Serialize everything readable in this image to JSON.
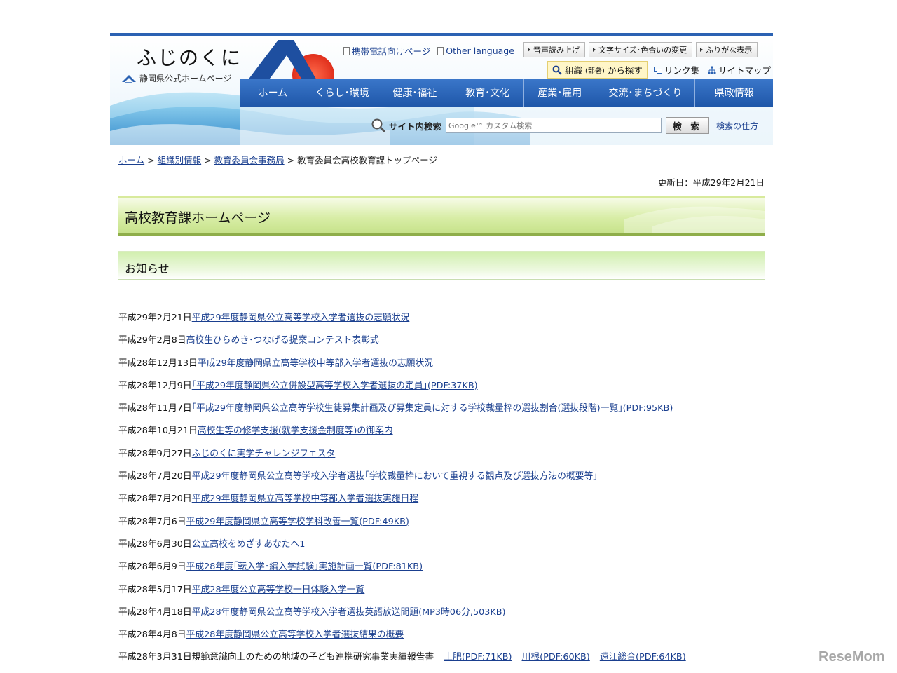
{
  "header": {
    "logo_title": "ふじのくに",
    "logo_subtitle": "静岡県公式ホームページ",
    "util_links": [
      "携帯電話向けページ",
      "Other language"
    ],
    "tool_buttons": [
      "音声読み上げ",
      "文字サイズ･色合いの変更",
      "ふりがな表示"
    ],
    "org_search": {
      "main": "組織",
      "small": "(部署)",
      "suffix": "から探す"
    },
    "aux_links": [
      "リンク集",
      "サイトマップ"
    ],
    "nav": [
      "ホーム",
      "くらし･環境",
      "健康･福祉",
      "教育･文化",
      "産業･雇用",
      "交流･まちづくり",
      "県政情報"
    ],
    "search": {
      "label": "サイト内検索",
      "placeholder": "Google™ カスタム検索",
      "button": "検 索",
      "help": "検索の仕方"
    }
  },
  "breadcrumb": [
    "ホーム",
    "組織別情報",
    "教育委員会事務局",
    "教育委員会高校教育課トップページ"
  ],
  "updated": "更新日：平成29年2月21日",
  "page_title": "高校教育課ホームページ",
  "notice_heading": "お知らせ",
  "news": [
    {
      "date": "平成29年2月21日",
      "link": "平成29年度静岡県公立高等学校入学者選抜の志願状況"
    },
    {
      "date": "平成29年2月8日",
      "link": "高校生ひらめき･つなげる提案コンテスト表彰式"
    },
    {
      "date": "平成28年12月13日",
      "link": "平成29年度静岡県立高等学校中等部入学者選抜の志願状況"
    },
    {
      "date": "平成28年12月9日",
      "link": "｢平成29年度静岡県公立併設型高等学校入学者選抜の定員｣(PDF:37KB)"
    },
    {
      "date": "平成28年11月7日",
      "link": "｢平成29年度静岡県公立高等学校生徒募集計画及び募集定員に対する学校裁量枠の選抜割合(選抜段階)一覧｣(PDF:95KB)"
    },
    {
      "date": "平成28年10月21日",
      "link": "高校生等の修学支援(就学支援金制度等)の御案内"
    },
    {
      "date": "平成28年9月27日",
      "link": "ふじのくに実学チャレンジフェスタ"
    },
    {
      "date": "平成28年7月20日",
      "link": "平成29年度静岡県公立高等学校入学者選抜｢学校裁量枠において重視する観点及び選抜方法の概要等｣"
    },
    {
      "date": "平成28年7月20日",
      "link": "平成29年度静岡県立高等学校中等部入学者選抜実施日程"
    },
    {
      "date": "平成28年7月6日",
      "link": "平成29年度静岡県立高等学校学科改善一覧(PDF:49KB)"
    },
    {
      "date": "平成28年6月30日",
      "link": "公立高校をめざすあなたへ1"
    },
    {
      "date": "平成28年6月9日",
      "link": "平成28年度｢転入学･編入学試験｣実施計画一覧(PDF:81KB)"
    },
    {
      "date": "平成28年5月17日",
      "link": "平成28年度公立高等学校一日体験入学一覧"
    },
    {
      "date": "平成28年4月18日",
      "link": "平成28年度静岡県公立高等学校入学者選抜英語放送問題(MP3時06分,503KB)"
    },
    {
      "date": "平成28年4月8日",
      "link": "平成28年度静岡県公立高等学校入学者選抜結果の概要"
    }
  ],
  "last_news": {
    "date": "平成28年3月31日",
    "text": "規範意識向上のための地域の子ども連携研究事業実績報告書",
    "links": [
      "土肥(PDF:71KB)",
      "川根(PDF:60KB)",
      "遠江総合(PDF:64KB)"
    ]
  },
  "watermark": "ReseMom",
  "colors": {
    "nav_blue": "#2b62b3",
    "link": "#1a3f8f",
    "title_green": "#8fae4a"
  }
}
